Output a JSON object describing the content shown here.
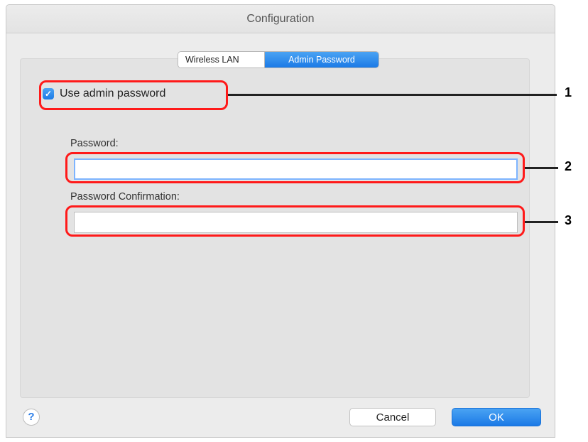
{
  "window": {
    "title": "Configuration"
  },
  "tabs": [
    {
      "label": "Wireless LAN",
      "selected": false
    },
    {
      "label": "Admin Password",
      "selected": true
    }
  ],
  "admin": {
    "use_admin_password_label": "Use admin password",
    "use_admin_password_checked": true,
    "password_label": "Password:",
    "password_value": "",
    "confirm_label": "Password Confirmation:",
    "confirm_value": ""
  },
  "callouts": [
    "1",
    "2",
    "3"
  ],
  "buttons": {
    "help_label": "?",
    "cancel_label": "Cancel",
    "ok_label": "OK"
  },
  "colors": {
    "accent": "#1b7ae6",
    "callout": "#ff1a1a"
  }
}
